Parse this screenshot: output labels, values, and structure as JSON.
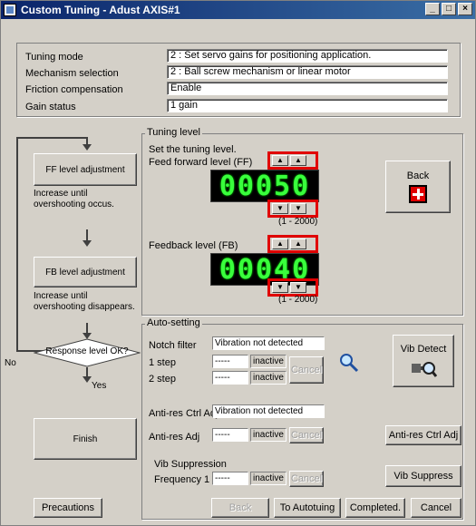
{
  "window": {
    "title": "Custom Tuning - Adust AXIS#1",
    "controls": [
      "_",
      "□",
      "×"
    ]
  },
  "info": {
    "rows": [
      {
        "label": "Tuning mode",
        "value": "2 : Set servo gains for positioning application."
      },
      {
        "label": "Mechanism selection",
        "value": "2 : Ball screw mechanism or linear motor"
      },
      {
        "label": "Friction compensation",
        "value": "Enable"
      },
      {
        "label": "Gain status",
        "value": "1 gain"
      }
    ]
  },
  "flow": {
    "ff_box": "FF level adjustment",
    "ff_note": "Increase until overshooting occus.",
    "fb_box": "FB level adjustment",
    "fb_note": "Increase until overshooting disappears.",
    "decision": "Response level OK?",
    "no_label": "No",
    "yes_label": "Yes",
    "finish": "Finish"
  },
  "tuning_level": {
    "legend": "Tuning level",
    "instruction": "Set the tuning level.",
    "ff_label": "Feed forward level (FF)",
    "ff_value": "00050",
    "ff_range": "(1 - 2000)",
    "fb_label": "Feedback level (FB)",
    "fb_value": "00040",
    "fb_range": "(1 - 2000)",
    "back_label": "Back",
    "up_arrow": "▲",
    "down_arrow": "▼"
  },
  "auto_setting": {
    "legend": "Auto-setting",
    "notch_label": "Notch filter",
    "notch_status": "Vibration not detected",
    "step1_label": "1 step",
    "step1_value": "-----",
    "step1_state": "inactive",
    "step2_label": "2 step",
    "step2_value": "-----",
    "step2_state": "inactive",
    "cancel_label": "Cancel",
    "vib_detect_label": "Vib Detect",
    "antires_ctrl_label": "Anti-res Ctrl Adj",
    "antires_status": "Vibration not detected",
    "antires_adj_label": "Anti-res Adj",
    "antires_value": "-----",
    "antires_state": "inactive",
    "antires_cancel": "Cancel",
    "antires_button": "Anti-res Ctrl Adj",
    "vib_supp_label": "Vib Suppression",
    "freq1_label": "Frequency 1",
    "freq1_value": "-----",
    "freq1_state": "inactive",
    "freq1_cancel": "Cancel",
    "vib_suppress_button": "Vib Suppress"
  },
  "footer": {
    "precautions": "Precautions",
    "back": "Back",
    "to_autotuning": "To Autotuing",
    "completed": "Completed.",
    "cancel": "Cancel"
  },
  "colors": {
    "title_bar": "#0a246a",
    "segment_digits": "#39ff3c",
    "highlight": "#e00000",
    "back_icon": "#e00000"
  }
}
